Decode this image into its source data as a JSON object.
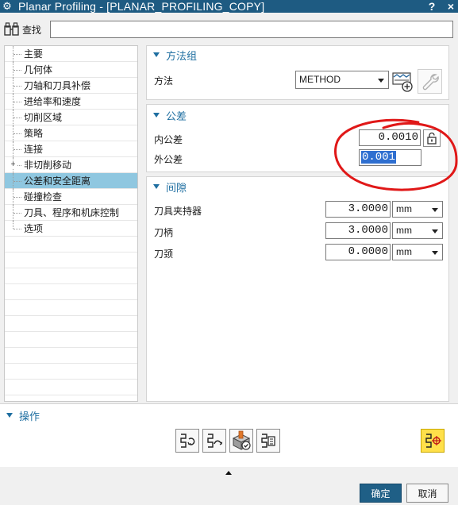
{
  "window": {
    "title": "Planar Profiling - [PLANAR_PROFILING_COPY]",
    "help_glyph": "?",
    "close_glyph": "×"
  },
  "search": {
    "label": "查找",
    "value": ""
  },
  "tree": {
    "items": [
      {
        "label": "主要",
        "expandable": false,
        "selected": false
      },
      {
        "label": "几何体",
        "expandable": false,
        "selected": false
      },
      {
        "label": "刀轴和刀具补偿",
        "expandable": false,
        "selected": false
      },
      {
        "label": "进给率和速度",
        "expandable": false,
        "selected": false
      },
      {
        "label": "切削区域",
        "expandable": false,
        "selected": false
      },
      {
        "label": "策略",
        "expandable": false,
        "selected": false
      },
      {
        "label": "连接",
        "expandable": false,
        "selected": false
      },
      {
        "label": "非切削移动",
        "expandable": true,
        "selected": false
      },
      {
        "label": "公差和安全距离",
        "expandable": false,
        "selected": true
      },
      {
        "label": "碰撞检查",
        "expandable": false,
        "selected": false
      },
      {
        "label": "刀具、程序和机床控制",
        "expandable": false,
        "selected": false
      },
      {
        "label": "选项",
        "expandable": false,
        "selected": false
      }
    ],
    "expander_glyph": "+"
  },
  "method_group": {
    "header": "方法组",
    "method_label": "方法",
    "method_value": "METHOD"
  },
  "tolerance": {
    "header": "公差",
    "inner_label": "内公差",
    "inner_value": "0.0010",
    "outer_label": "外公差",
    "outer_value": "0.001"
  },
  "clearance": {
    "header": "间隙",
    "rows": [
      {
        "label": "刀具夹持器",
        "value": "3.0000",
        "unit": "mm"
      },
      {
        "label": "刀柄",
        "value": "3.0000",
        "unit": "mm"
      },
      {
        "label": "刀颈",
        "value": "0.0000",
        "unit": "mm"
      }
    ]
  },
  "operations": {
    "header": "操作"
  },
  "footer": {
    "ok_label": "确定",
    "cancel_label": "取消"
  },
  "colors": {
    "titlebar": "#1e5b82",
    "accent": "#1f6fa1",
    "selection": "#8fc7e0",
    "annotation": "#e01818",
    "ok_button": "#1f5f86",
    "highlight_tool": "#ffe04a"
  },
  "icons": [
    "gear-icon",
    "binoculars-icon",
    "method-create-icon",
    "wrench-icon",
    "lock-icon",
    "generate-icon",
    "replay-icon",
    "verify-icon",
    "list-icon",
    "info-icon"
  ]
}
